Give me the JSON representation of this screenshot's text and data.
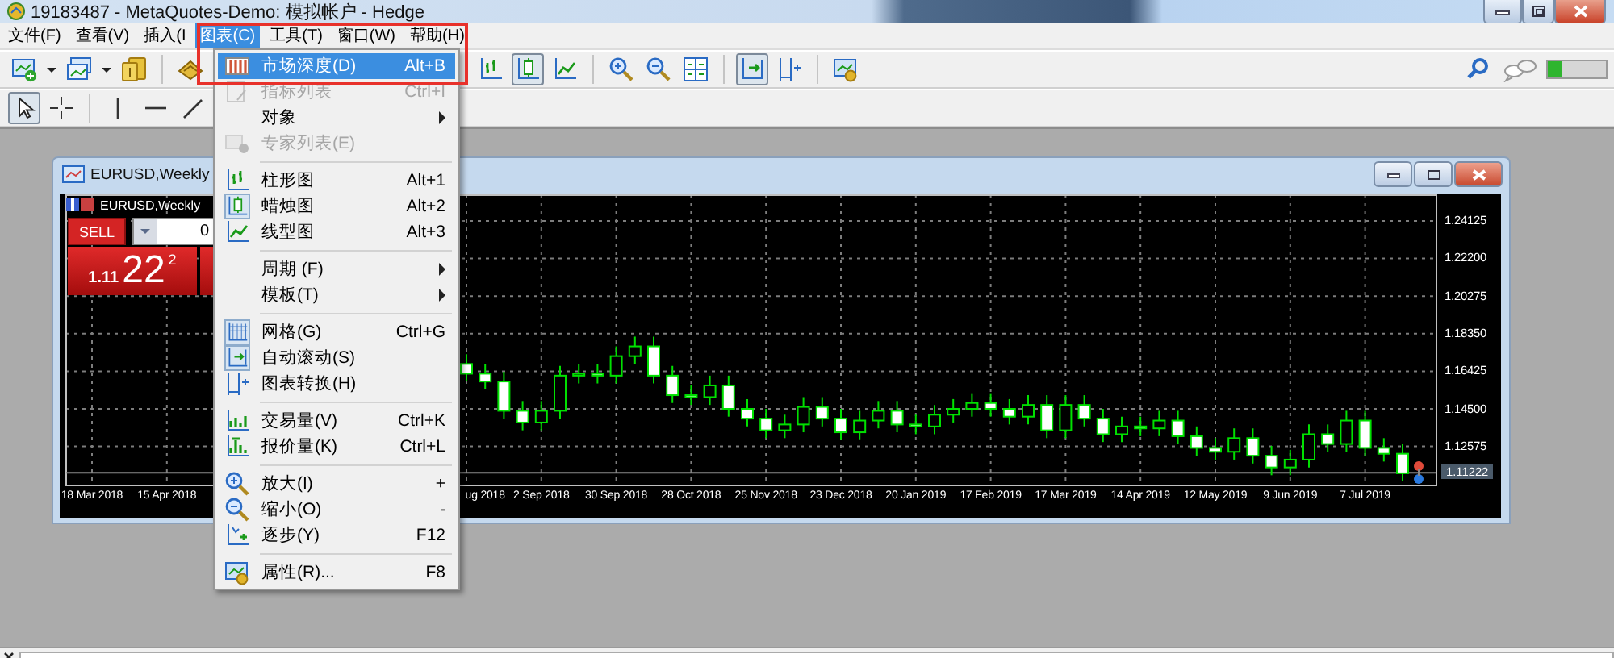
{
  "window": {
    "title": "19183487 - MetaQuotes-Demo: 模拟帐户 - Hedge"
  },
  "menu_bar": [
    {
      "label": "文件(F)",
      "selected": false
    },
    {
      "label": "查看(V)",
      "selected": false
    },
    {
      "label": "插入(I",
      "selected": false
    },
    {
      "label": "图表(C)",
      "selected": true
    },
    {
      "label": "工具(T)",
      "selected": false
    },
    {
      "label": "窗口(W)",
      "selected": false
    },
    {
      "label": "帮助(H)",
      "selected": false
    }
  ],
  "main_toolbar": {
    "toggles": [
      {
        "pressed": false
      },
      {
        "pressed": true
      },
      {
        "pressed": false
      },
      {
        "pressed": true
      },
      {
        "pressed": false
      }
    ]
  },
  "drawing_toolbar": {
    "tools": [
      {
        "pressed": true
      },
      {
        "pressed": false
      },
      {
        "pressed": false
      },
      {
        "pressed": false
      },
      {
        "pressed": false
      }
    ]
  },
  "chart_menu": [
    {
      "kind": "item",
      "label": "市场深度(D)",
      "shortcut": "Alt+B",
      "selected": true,
      "disabled": false,
      "checked": false
    },
    {
      "kind": "item",
      "label": "指标列表",
      "shortcut": "Ctrl+I",
      "selected": false,
      "disabled": true,
      "checked": false
    },
    {
      "kind": "submenu",
      "label": "对象",
      "selected": false,
      "disabled": false
    },
    {
      "kind": "item",
      "label": "专家列表(E)",
      "selected": false,
      "disabled": true,
      "checked": false
    },
    {
      "kind": "separator"
    },
    {
      "kind": "item",
      "label": "柱形图",
      "shortcut": "Alt+1",
      "selected": false,
      "disabled": false,
      "checked": false
    },
    {
      "kind": "item",
      "label": "蜡烛图",
      "shortcut": "Alt+2",
      "selected": false,
      "disabled": false,
      "checked": true
    },
    {
      "kind": "item",
      "label": "线型图",
      "shortcut": "Alt+3",
      "selected": false,
      "disabled": false,
      "checked": false
    },
    {
      "kind": "separator"
    },
    {
      "kind": "submenu",
      "label": "周期 (F)",
      "selected": false,
      "disabled": false
    },
    {
      "kind": "submenu",
      "label": "模板(T)",
      "selected": false,
      "disabled": false
    },
    {
      "kind": "separator"
    },
    {
      "kind": "item",
      "label": "网格(G)",
      "shortcut": "Ctrl+G",
      "selected": false,
      "disabled": false,
      "checked": true
    },
    {
      "kind": "item",
      "label": "自动滚动(S)",
      "selected": false,
      "disabled": false,
      "checked": true
    },
    {
      "kind": "item",
      "label": "图表转换(H)",
      "selected": false,
      "disabled": false,
      "checked": false
    },
    {
      "kind": "separator"
    },
    {
      "kind": "item",
      "label": "交易量(V)",
      "shortcut": "Ctrl+K",
      "selected": false,
      "disabled": false,
      "checked": false
    },
    {
      "kind": "item",
      "label": "报价量(K)",
      "shortcut": "Ctrl+L",
      "selected": false,
      "disabled": false,
      "checked": false
    },
    {
      "kind": "separator"
    },
    {
      "kind": "item",
      "label": "放大(I)",
      "shortcut": "+",
      "selected": false,
      "disabled": false,
      "checked": false
    },
    {
      "kind": "item",
      "label": "缩小(O)",
      "shortcut": "-",
      "selected": false,
      "disabled": false,
      "checked": false
    },
    {
      "kind": "item",
      "label": "逐步(Y)",
      "shortcut": "F12",
      "selected": false,
      "disabled": false,
      "checked": false
    },
    {
      "kind": "separator"
    },
    {
      "kind": "item",
      "label": "属性(R)...",
      "shortcut": "F8",
      "selected": false,
      "disabled": false,
      "checked": false
    }
  ],
  "chart_window": {
    "title": "EURUSD,Weekly",
    "symbol_label": "EURUSD,Weekly",
    "trade_panel": {
      "sell_label": "SELL",
      "lot": "0",
      "price_prefix": "1.11",
      "price_main": "22",
      "price_sup": "2"
    },
    "chart_data": {
      "type": "candlestick",
      "grid": true,
      "ref_lines": [
        {
          "axis": "y",
          "value": 1.11222,
          "label": "1.11222"
        }
      ],
      "categories": [
        "18 Mar 2018",
        null,
        null,
        null,
        "15 Apr 2018",
        null,
        null,
        null,
        null,
        null,
        null,
        null,
        null,
        null,
        null,
        null,
        null,
        null,
        null,
        null,
        null,
        "ug 2018",
        null,
        null,
        "2 Sep 2018",
        null,
        null,
        null,
        "30 Sep 2018",
        null,
        null,
        null,
        "28 Oct 2018",
        null,
        null,
        null,
        "25 Nov 2018",
        null,
        null,
        null,
        "23 Dec 2018",
        null,
        null,
        null,
        "20 Jan 2019",
        null,
        null,
        null,
        "17 Feb 2019",
        null,
        null,
        null,
        "17 Mar 2019",
        null,
        null,
        null,
        "14 Apr 2019",
        null,
        null,
        null,
        "12 May 2019",
        null,
        null,
        null,
        "9 Jun 2019",
        null,
        null,
        null,
        "7 Jul 2019",
        null,
        null
      ],
      "ylim": [
        1.10576,
        1.25447
      ],
      "ohlc": [
        null,
        null,
        null,
        null,
        null,
        null,
        null,
        null,
        null,
        null,
        null,
        null,
        null,
        null,
        null,
        null,
        null,
        null,
        null,
        null,
        [
          1.168,
          1.173,
          1.159,
          1.163
        ],
        [
          1.163,
          1.168,
          1.155,
          1.159
        ],
        [
          1.159,
          1.164,
          1.14,
          1.144
        ],
        [
          1.144,
          1.149,
          1.134,
          1.138
        ],
        [
          1.138,
          1.149,
          1.134,
          1.144
        ],
        [
          1.144,
          1.167,
          1.14,
          1.162
        ],
        [
          1.162,
          1.168,
          1.158,
          1.163
        ],
        [
          1.163,
          1.168,
          1.158,
          1.162
        ],
        [
          1.162,
          1.177,
          1.158,
          1.172
        ],
        [
          1.172,
          1.182,
          1.168,
          1.177
        ],
        [
          1.177,
          1.182,
          1.158,
          1.162
        ],
        [
          1.162,
          1.167,
          1.148,
          1.152
        ],
        [
          1.152,
          1.157,
          1.147,
          1.151
        ],
        [
          1.151,
          1.162,
          1.147,
          1.157
        ],
        [
          1.157,
          1.162,
          1.141,
          1.145
        ],
        [
          1.145,
          1.15,
          1.136,
          1.14
        ],
        [
          1.14,
          1.145,
          1.13,
          1.134
        ],
        [
          1.134,
          1.142,
          1.13,
          1.137
        ],
        [
          1.137,
          1.151,
          1.133,
          1.146
        ],
        [
          1.146,
          1.151,
          1.136,
          1.14
        ],
        [
          1.14,
          1.145,
          1.129,
          1.133
        ],
        [
          1.133,
          1.144,
          1.129,
          1.139
        ],
        [
          1.139,
          1.149,
          1.135,
          1.144
        ],
        [
          1.144,
          1.149,
          1.133,
          1.137
        ],
        [
          1.137,
          1.142,
          1.132,
          1.136
        ],
        [
          1.136,
          1.147,
          1.132,
          1.142
        ],
        [
          1.142,
          1.15,
          1.138,
          1.145
        ],
        [
          1.145,
          1.153,
          1.141,
          1.148
        ],
        [
          1.148,
          1.153,
          1.141,
          1.145
        ],
        [
          1.145,
          1.15,
          1.137,
          1.141
        ],
        [
          1.141,
          1.152,
          1.137,
          1.147
        ],
        [
          1.147,
          1.152,
          1.13,
          1.134
        ],
        [
          1.134,
          1.152,
          1.13,
          1.147
        ],
        [
          1.147,
          1.152,
          1.136,
          1.14
        ],
        [
          1.14,
          1.145,
          1.128,
          1.132
        ],
        [
          1.132,
          1.141,
          1.128,
          1.136
        ],
        [
          1.136,
          1.141,
          1.131,
          1.135
        ],
        [
          1.135,
          1.144,
          1.131,
          1.139
        ],
        [
          1.139,
          1.144,
          1.127,
          1.131
        ],
        [
          1.131,
          1.136,
          1.121,
          1.125
        ],
        [
          1.125,
          1.13,
          1.119,
          1.123
        ],
        [
          1.123,
          1.135,
          1.119,
          1.13
        ],
        [
          1.13,
          1.135,
          1.117,
          1.121
        ],
        [
          1.121,
          1.126,
          1.111,
          1.115
        ],
        [
          1.115,
          1.124,
          1.111,
          1.119
        ],
        [
          1.119,
          1.137,
          1.115,
          1.132
        ],
        [
          1.132,
          1.137,
          1.123,
          1.127
        ],
        [
          1.127,
          1.144,
          1.123,
          1.139
        ],
        [
          1.139,
          1.144,
          1.121,
          1.125
        ],
        [
          1.125,
          1.13,
          1.118,
          1.122
        ],
        [
          1.122,
          1.127,
          1.108,
          1.112
        ]
      ],
      "yticks": [
        {
          "value": 1.24125,
          "label": "1.24125"
        },
        {
          "value": 1.222,
          "label": "1.22200"
        },
        {
          "value": 1.20275,
          "label": "1.20275"
        },
        {
          "value": 1.1835,
          "label": "1.18350"
        },
        {
          "value": 1.16425,
          "label": "1.16425"
        },
        {
          "value": 1.145,
          "label": "1.14500"
        },
        {
          "value": 1.12575,
          "label": "1.12575"
        }
      ]
    }
  }
}
